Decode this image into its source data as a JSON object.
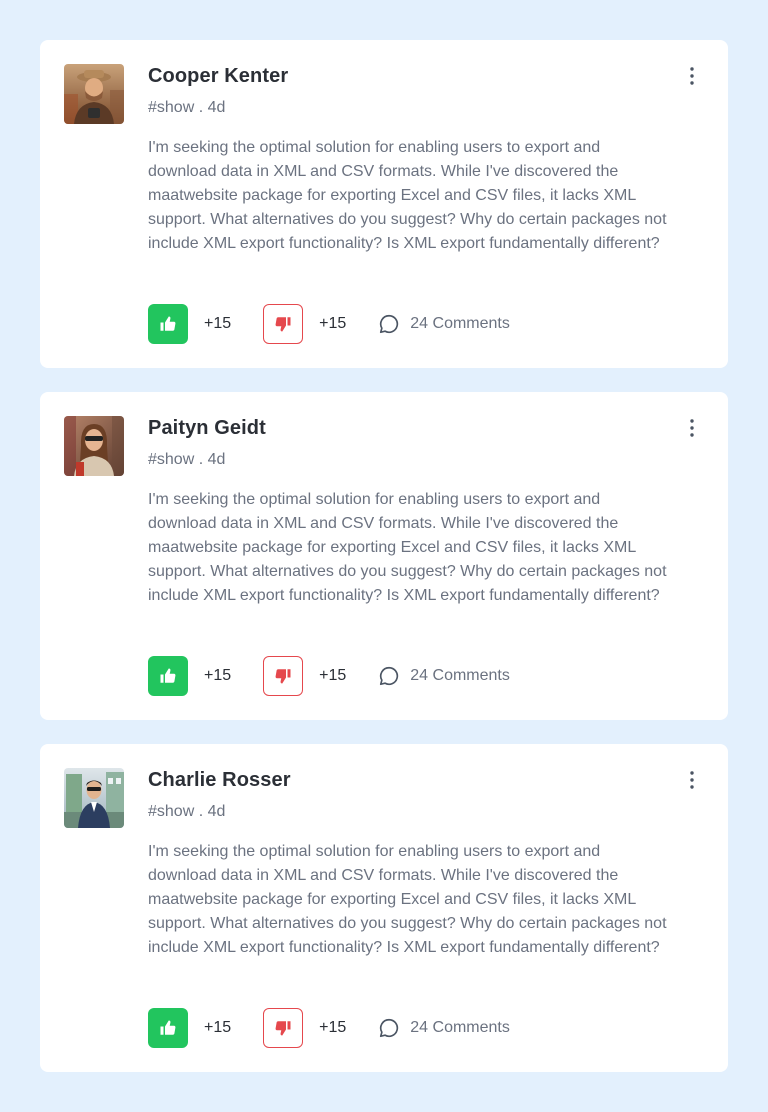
{
  "posts": [
    {
      "author": "Cooper Kenter",
      "meta": "#show . 4d",
      "body": "I'm seeking the optimal solution for enabling users to export and download data in XML and CSV formats. While I've discovered the maatwebsite package for exporting Excel and CSV files, it lacks XML support. What alternatives do you suggest? Why do certain packages not include XML export functionality? Is XML export fundamentally different?",
      "likes": "+15",
      "dislikes": "+15",
      "comments": "24 Comments"
    },
    {
      "author": "Paityn Geidt",
      "meta": "#show . 4d",
      "body": "I'm seeking the optimal solution for enabling users to export and download data in XML and CSV formats. While I've discovered the maatwebsite package for exporting Excel and CSV files, it lacks XML support. What alternatives do you suggest? Why do certain packages not include XML export functionality? Is XML export fundamentally different?",
      "likes": "+15",
      "dislikes": "+15",
      "comments": "24 Comments"
    },
    {
      "author": "Charlie Rosser",
      "meta": "#show . 4d",
      "body": "I'm seeking the optimal solution for enabling users to export and download data in XML and CSV formats. While I've discovered the maatwebsite package for exporting Excel and CSV files, it lacks XML support. What alternatives do you suggest? Why do certain packages not include XML export functionality? Is XML export fundamentally different?",
      "likes": "+15",
      "dislikes": "+15",
      "comments": "24 Comments"
    }
  ],
  "icons": {
    "like": "thumbs-up-icon",
    "dislike": "thumbs-down-icon",
    "comment": "comment-bubble-icon",
    "more": "vertical-dots-icon"
  },
  "colors": {
    "background": "#e3f0fd",
    "card": "#ffffff",
    "like": "#22c55e",
    "dislike": "#e5484d",
    "muted_text": "#6b7280",
    "primary_text": "#2b2f36"
  }
}
